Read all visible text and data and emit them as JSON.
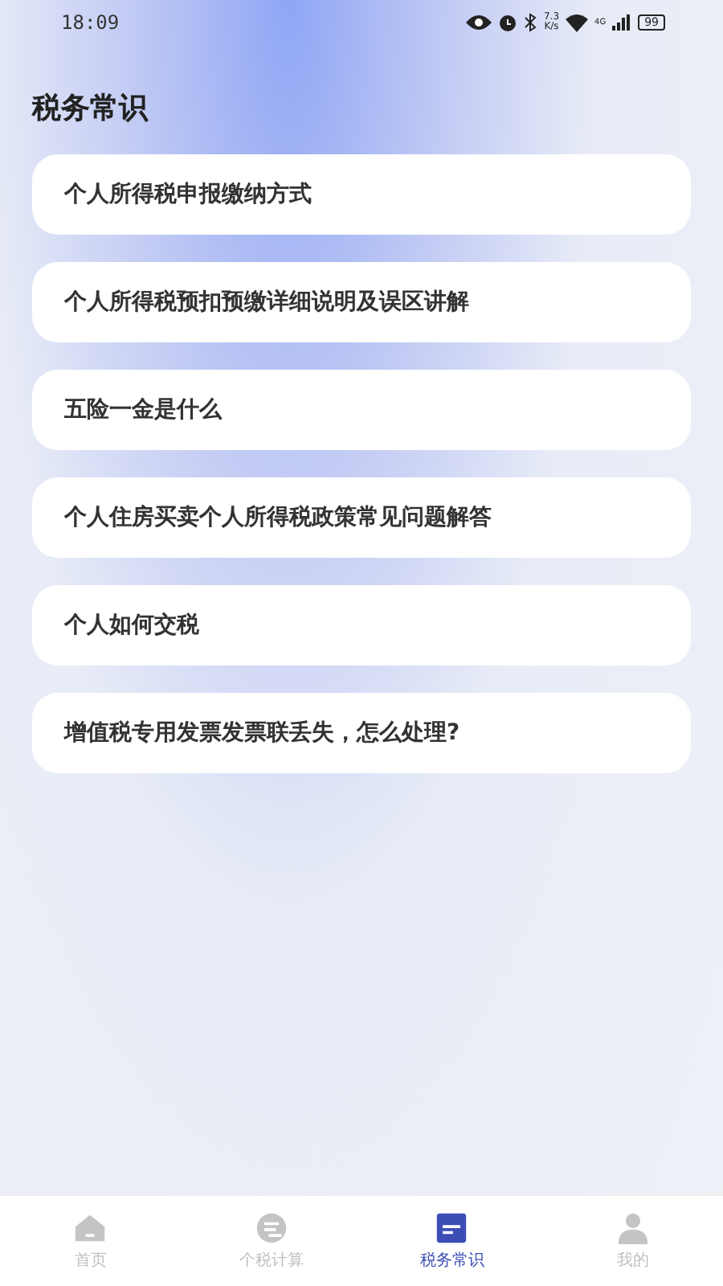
{
  "status_bar": {
    "time": "18:09",
    "speed": "7.3\nK/s",
    "signal_label": "4G",
    "battery": "99"
  },
  "title": "税务常识",
  "articles": [
    {
      "title": "个人所得税申报缴纳方式"
    },
    {
      "title": "个人所得税预扣预缴详细说明及误区讲解"
    },
    {
      "title": "五险一金是什么"
    },
    {
      "title": "个人住房买卖个人所得税政策常见问题解答"
    },
    {
      "title": "个人如何交税"
    },
    {
      "title": "增值税专用发票发票联丢失，怎么处理?"
    }
  ],
  "tabs": [
    {
      "label": "首页",
      "kind": "home",
      "selected": false
    },
    {
      "label": "个税计算",
      "kind": "calc",
      "selected": false
    },
    {
      "label": "税务常识",
      "kind": "knowledge",
      "selected": true
    },
    {
      "label": "我的",
      "kind": "profile",
      "selected": false
    }
  ]
}
